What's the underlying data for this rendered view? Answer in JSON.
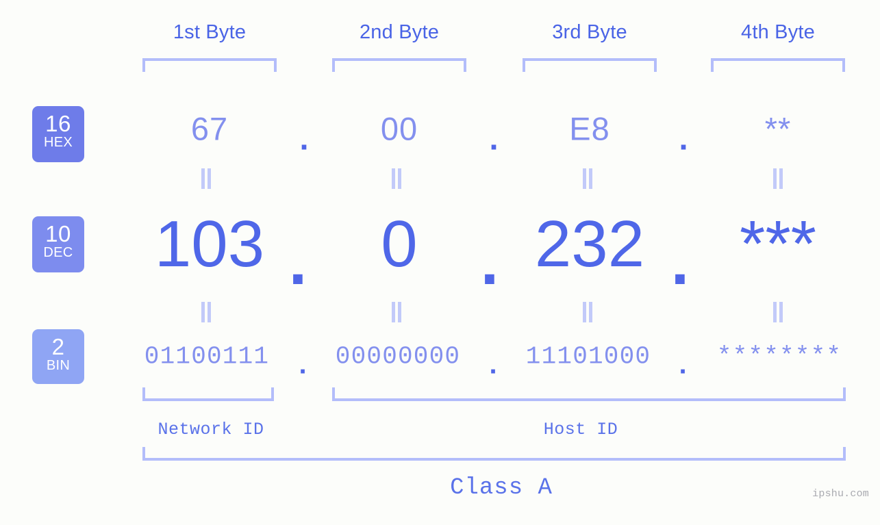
{
  "meta": {
    "watermark": "ipshu.com",
    "background_color": "#fcfdfa",
    "accent_color": "#4f67e8",
    "bracket_color": "#b3bdfa",
    "connector_color": "#c2caf9"
  },
  "byte_headers": [
    {
      "label": "1st Byte"
    },
    {
      "label": "2nd Byte"
    },
    {
      "label": "3rd Byte"
    },
    {
      "label": "4th Byte"
    }
  ],
  "bases": [
    {
      "number": "16",
      "abbr": "HEX",
      "color": "#6e7ce9"
    },
    {
      "number": "10",
      "abbr": "DEC",
      "color": "#7d8cee"
    },
    {
      "number": "2",
      "abbr": "BIN",
      "color": "#8fa5f4"
    }
  ],
  "separator": ".",
  "rows": {
    "hex": {
      "values": [
        "67",
        "00",
        "E8",
        "**"
      ]
    },
    "dec": {
      "values": [
        "103",
        "0",
        "232",
        "***"
      ]
    },
    "bin": {
      "values": [
        "01100111",
        "00000000",
        "11101000",
        "********"
      ]
    }
  },
  "segments": {
    "network_id": "Network ID",
    "host_id": "Host ID",
    "class": "Class A"
  }
}
